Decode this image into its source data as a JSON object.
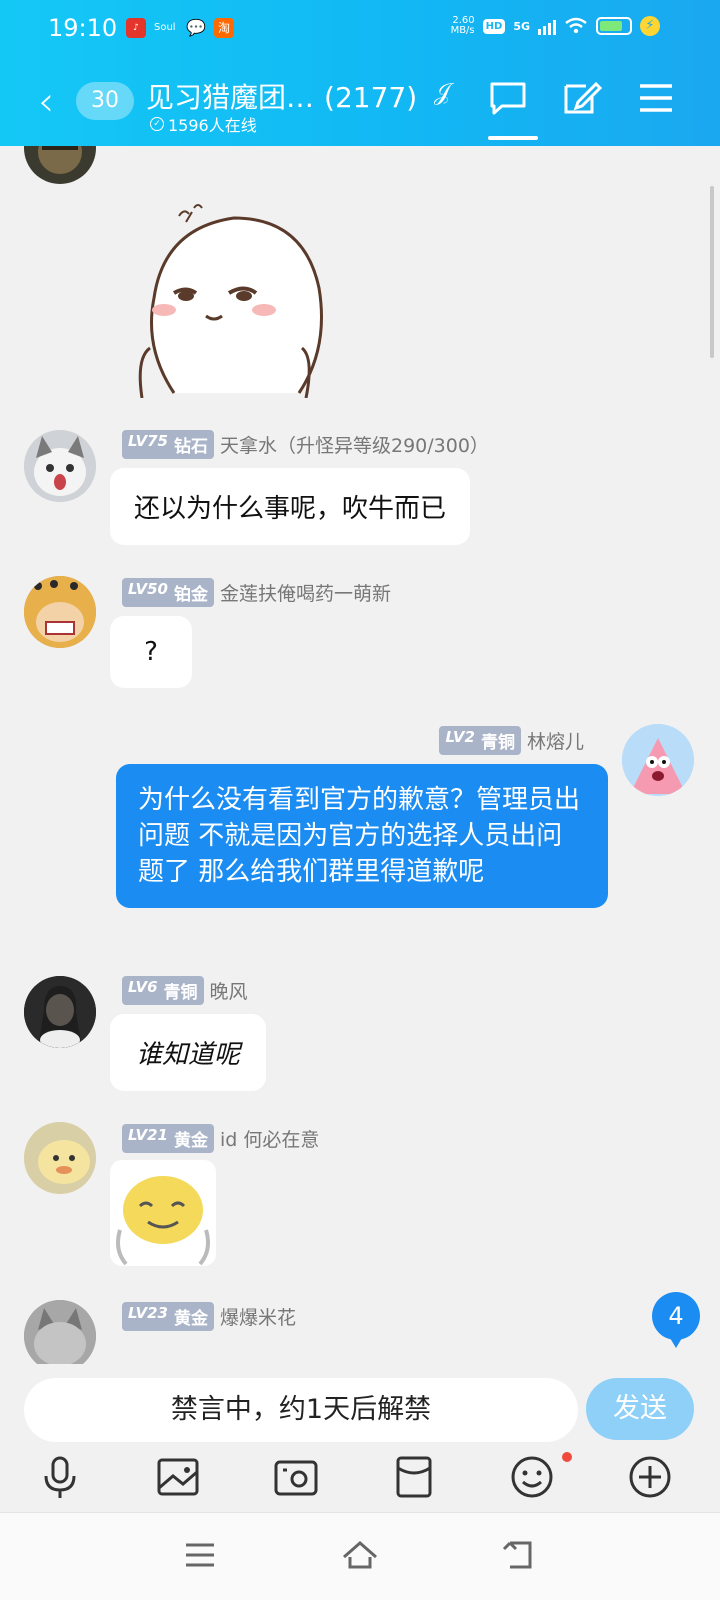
{
  "status": {
    "time": "19:10",
    "apps": [
      "网易云",
      "Soul",
      "微信",
      "淘"
    ],
    "net_speed": "2.60",
    "net_unit": "MB/s",
    "hd": "HD",
    "signal": "5G"
  },
  "header": {
    "unread": "30",
    "group_name": "见习猎魔团…",
    "member_count": "(2177)",
    "online": "1596人在线"
  },
  "messages": [
    {
      "kind": "sticker",
      "sender": "",
      "desc": "sticker-smug-face"
    },
    {
      "lv": "LV75",
      "rank": "钻石",
      "name": "天拿水（升怪异等级290/300）",
      "text": "还以为什么事呢，吹牛而已"
    },
    {
      "lv": "LV50",
      "rank": "铂金",
      "name": "金莲扶俺喝药一萌新",
      "text": "?"
    },
    {
      "lv": "LV2",
      "rank": "青铜",
      "name": "林熔儿",
      "text": "为什么没有看到官方的歉意？管理员出问题 不就是因为官方的选择人员出问题了 那么给我们群里得道歉呢",
      "mine": true
    },
    {
      "lv": "LV6",
      "rank": "青铜",
      "name": "晚风",
      "text": "谁知道呢"
    },
    {
      "lv": "LV21",
      "rank": "黄金",
      "name": "id  何必在意",
      "text": ""
    },
    {
      "lv": "LV23",
      "rank": "黄金",
      "name": "爆爆米花",
      "text": ""
    }
  ],
  "new_count": "4",
  "input": {
    "placeholder": "禁言中，约1天后解禁",
    "send": "发送"
  },
  "colors": {
    "header": "#14c8f6",
    "my_bubble": "#1a8cf2",
    "level_badge": "#aab4c8"
  }
}
